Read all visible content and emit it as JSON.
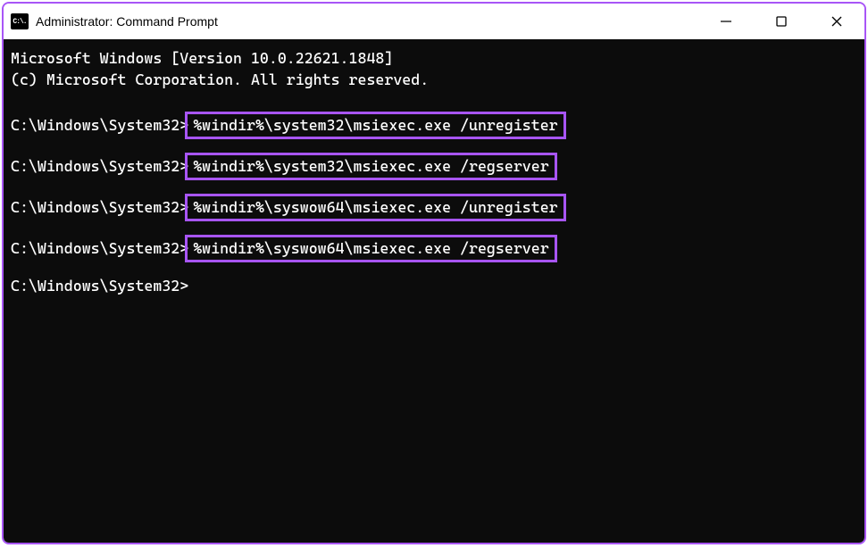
{
  "window": {
    "iconText": "C:\\.",
    "title": "Administrator: Command Prompt"
  },
  "terminal": {
    "line1": "Microsoft Windows [Version 10.0.22621.1848]",
    "line2": "(c) Microsoft Corporation. All rights reserved.",
    "prompt": "C:\\Windows\\System32>",
    "commands": {
      "c1": "%windir%\\system32\\msiexec.exe /unregister",
      "c2": "%windir%\\system32\\msiexec.exe /regserver",
      "c3": "%windir%\\syswow64\\msiexec.exe /unregister",
      "c4": "%windir%\\syswow64\\msiexec.exe /regserver"
    }
  }
}
